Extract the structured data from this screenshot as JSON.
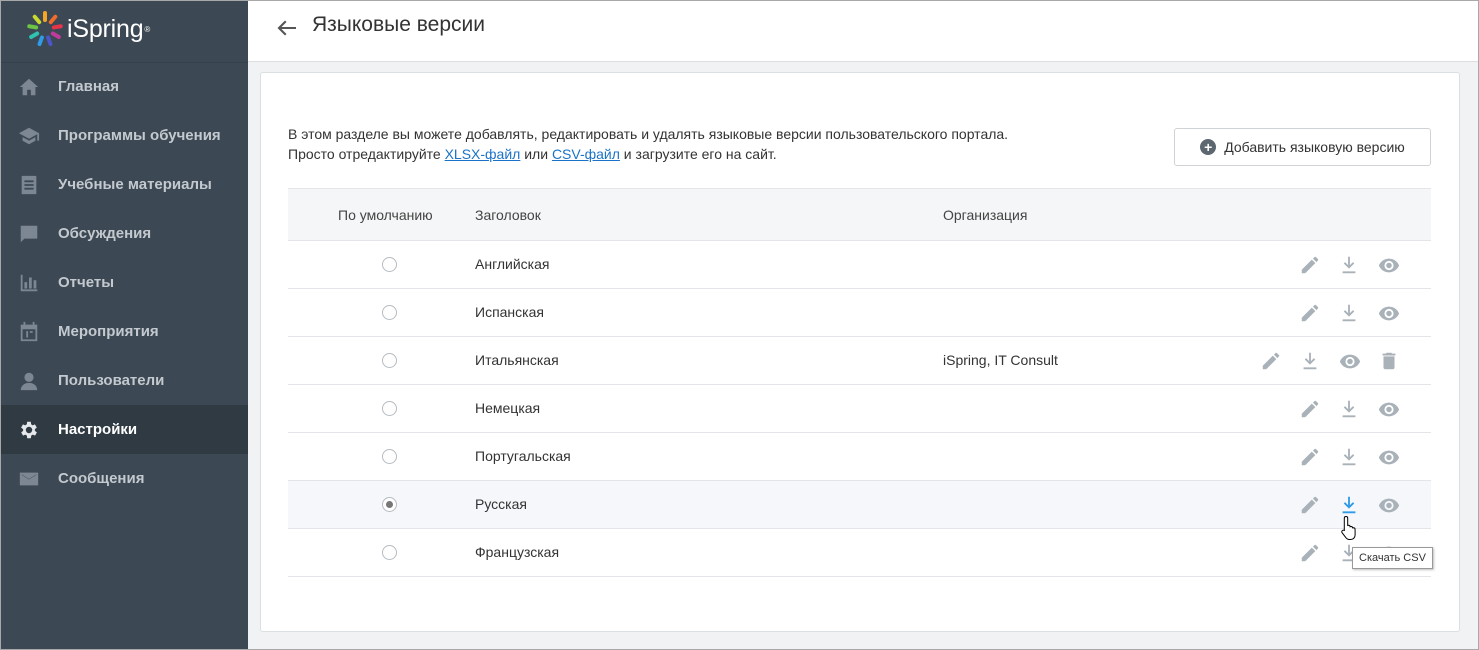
{
  "app": {
    "logo_text": "iSpring"
  },
  "sidebar": {
    "items": [
      {
        "label": "Главная",
        "icon": "home-icon"
      },
      {
        "label": "Программы обучения",
        "icon": "graduation-cap-icon"
      },
      {
        "label": "Учебные материалы",
        "icon": "materials-icon"
      },
      {
        "label": "Обсуждения",
        "icon": "chat-icon"
      },
      {
        "label": "Отчеты",
        "icon": "bar-chart-icon"
      },
      {
        "label": "Мероприятия",
        "icon": "calendar-icon"
      },
      {
        "label": "Пользователи",
        "icon": "user-icon"
      },
      {
        "label": "Настройки",
        "icon": "gear-icon",
        "active": true
      },
      {
        "label": "Сообщения",
        "icon": "envelope-icon"
      }
    ]
  },
  "header": {
    "title": "Языковые версии"
  },
  "intro": {
    "line1": "В этом разделе вы можете добавлять, редактировать и удалять языковые версии пользовательского портала.",
    "line2_prefix": "Просто отредактируйте ",
    "xlsx_link": "XLSX-файл",
    "or": " или ",
    "csv_link": "CSV-файл",
    "line2_suffix": " и загрузите его на сайт."
  },
  "add_button": {
    "label": "Добавить языковую версию"
  },
  "table": {
    "columns": {
      "default": "По умолчанию",
      "title": "Заголовок",
      "org": "Организация"
    },
    "rows": [
      {
        "name": "Английская",
        "org": "",
        "default": false,
        "deletable": false
      },
      {
        "name": "Испанская",
        "org": "",
        "default": false,
        "deletable": false
      },
      {
        "name": "Итальянская",
        "org": "iSpring, IT Consult",
        "default": false,
        "deletable": true
      },
      {
        "name": "Немецкая",
        "org": "",
        "default": false,
        "deletable": false
      },
      {
        "name": "Португальская",
        "org": "",
        "default": false,
        "deletable": false
      },
      {
        "name": "Русская",
        "org": "",
        "default": true,
        "deletable": false,
        "hover": true
      },
      {
        "name": "Французская",
        "org": "",
        "default": false,
        "deletable": false
      }
    ]
  },
  "tooltip": {
    "text": "Скачать CSV"
  },
  "colors": {
    "sidebar": "#3c4853",
    "active": "#2f3a43",
    "link": "#1a73c8",
    "icon": "#a9b1b9",
    "icon_active": "#2f9be6"
  }
}
